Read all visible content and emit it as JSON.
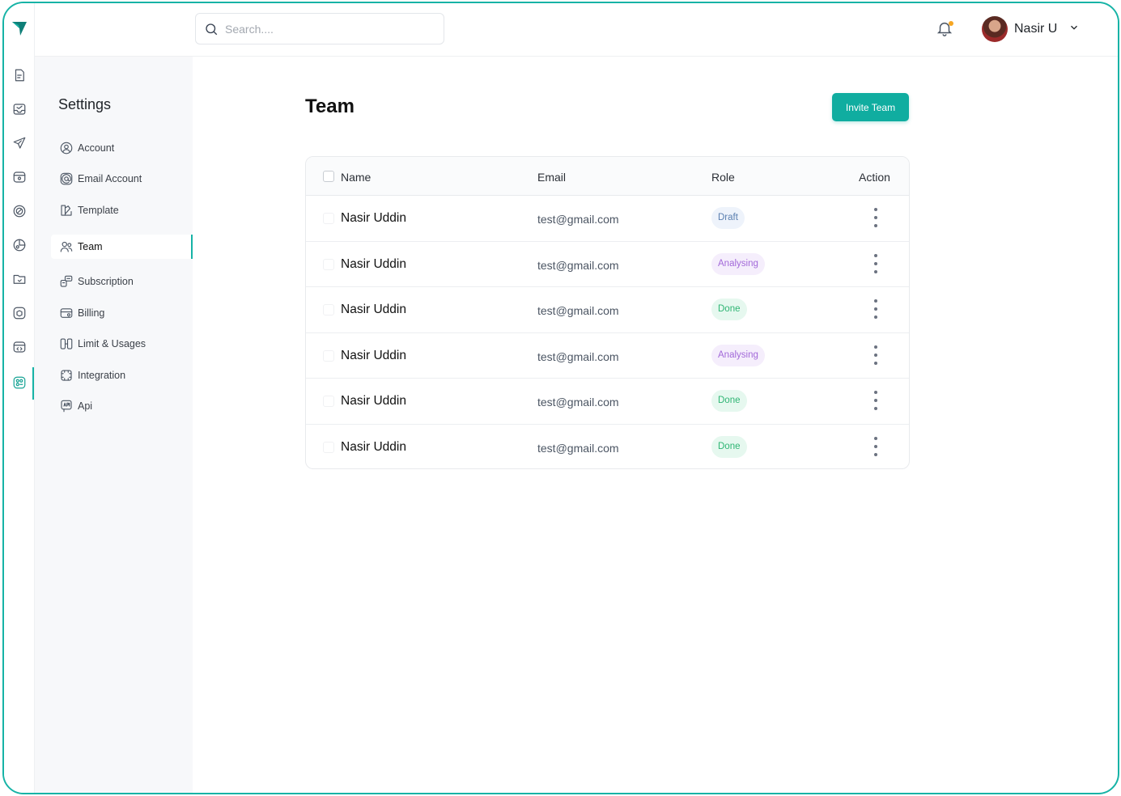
{
  "search": {
    "placeholder": "Search...."
  },
  "user": {
    "name": "Nasir U"
  },
  "settings": {
    "title": "Settings",
    "items": [
      {
        "label": "Account",
        "icon": "user-circle-icon"
      },
      {
        "label": "Email Account",
        "icon": "at-sign-icon"
      },
      {
        "label": "Template",
        "icon": "template-icon"
      },
      {
        "label": "Team",
        "icon": "users-icon",
        "active": true
      },
      {
        "label": "Subscription",
        "icon": "subscription-icon"
      },
      {
        "label": "Billing",
        "icon": "credit-card-icon"
      },
      {
        "label": "Limit & Usages",
        "icon": "limit-icon"
      },
      {
        "label": "Integration",
        "icon": "integration-icon"
      },
      {
        "label": "Api",
        "icon": "api-icon"
      }
    ]
  },
  "main": {
    "title": "Team",
    "invite_label": "Invite Team",
    "table": {
      "headers": {
        "name": "Name",
        "email": "Email",
        "role": "Role",
        "action": "Action"
      },
      "rows": [
        {
          "name": "Nasir Uddin",
          "email": "test@gmail.com",
          "role": "Draft"
        },
        {
          "name": "Nasir Uddin",
          "email": "test@gmail.com",
          "role": "Analysing"
        },
        {
          "name": "Nasir Uddin",
          "email": "test@gmail.com",
          "role": "Done"
        },
        {
          "name": "Nasir Uddin",
          "email": "test@gmail.com",
          "role": "Analysing"
        },
        {
          "name": "Nasir Uddin",
          "email": "test@gmail.com",
          "role": "Done"
        },
        {
          "name": "Nasir Uddin",
          "email": "test@gmail.com",
          "role": "Done"
        }
      ]
    }
  },
  "colors": {
    "accent": "#10ada0",
    "draft": "#5a7fb0",
    "analysing": "#a36ad9",
    "done": "#2fb574"
  }
}
